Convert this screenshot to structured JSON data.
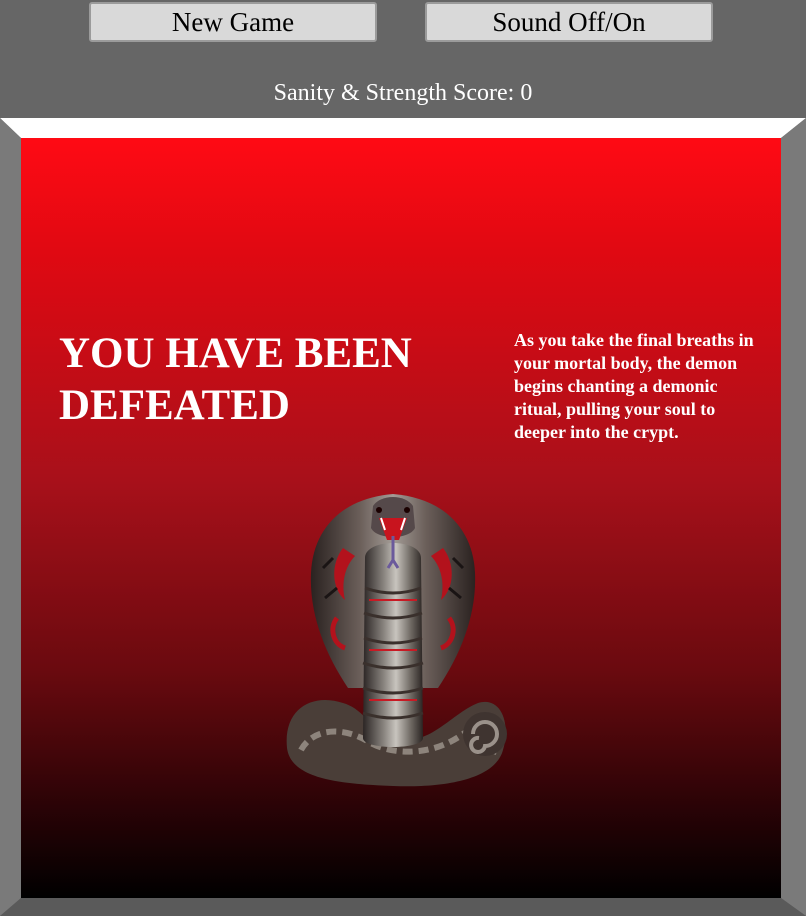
{
  "toolbar": {
    "new_game_label": "New Game",
    "sound_label": "Sound Off/On"
  },
  "score": {
    "text": "Sanity & Strength Score: 0"
  },
  "game": {
    "title": "YOU HAVE BEEN DEFEATED",
    "story": "As you take the final breaths in your mortal body, the demon begins chanting a demonic ritual, pulling your soul to deeper into the crypt.",
    "enemy_image": "cobra-demon-statue"
  },
  "colors": {
    "background": "#666666",
    "button": "#d9d9d9",
    "stage_top": "#ff0a14",
    "stage_bottom": "#000000",
    "text": "#ffffff"
  }
}
